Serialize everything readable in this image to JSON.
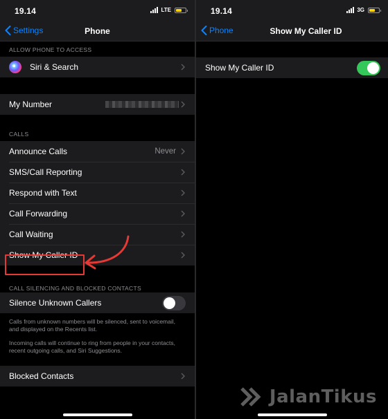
{
  "left": {
    "status": {
      "time": "19.14",
      "network": "LTE"
    },
    "nav": {
      "back": "Settings",
      "title": "Phone"
    },
    "sections": {
      "access_header": "ALLOW PHONE TO ACCESS",
      "siri_search": "Siri & Search",
      "my_number": "My Number",
      "calls_header": "CALLS",
      "announce_calls": "Announce Calls",
      "announce_calls_value": "Never",
      "sms_call_reporting": "SMS/Call Reporting",
      "respond_with_text": "Respond with Text",
      "call_forwarding": "Call Forwarding",
      "call_waiting": "Call Waiting",
      "show_my_caller_id": "Show My Caller ID",
      "silencing_header": "CALL SILENCING AND BLOCKED CONTACTS",
      "silence_unknown_callers": "Silence Unknown Callers",
      "silence_toggle_on": false,
      "footnote_1": "Calls from unknown numbers will be silenced, sent to voicemail, and displayed on the Recents list.",
      "footnote_2": "Incoming calls will continue to ring from people in your contacts, recent outgoing calls, and Siri Suggestions.",
      "blocked_contacts": "Blocked Contacts"
    }
  },
  "right": {
    "status": {
      "time": "19.14",
      "network": "3G"
    },
    "nav": {
      "back": "Phone",
      "title": "Show My Caller ID"
    },
    "show_my_caller_id": "Show My Caller ID",
    "caller_id_toggle_on": true
  },
  "watermark": {
    "text": "JalanTikus"
  },
  "colors": {
    "accent": "#0a84ff",
    "toggle_on": "#34c759",
    "highlight": "#e53935",
    "battery": "#ffd60a"
  }
}
